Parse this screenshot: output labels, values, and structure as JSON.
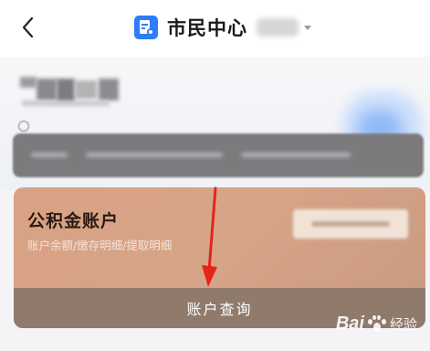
{
  "header": {
    "title": "市民中心",
    "icon": "back-icon",
    "colors": {
      "accent": "#2f7cf6"
    }
  },
  "card": {
    "title": "公积金账户",
    "subtitle": "账户余额/缴存明细/提取明细",
    "footer_button": "账户查询",
    "colors": {
      "card": "#d6a487",
      "footer": "#8f7a6c",
      "arrow": "#e6231b"
    }
  },
  "watermark": {
    "brand": "Bai",
    "suffix": "经验"
  }
}
